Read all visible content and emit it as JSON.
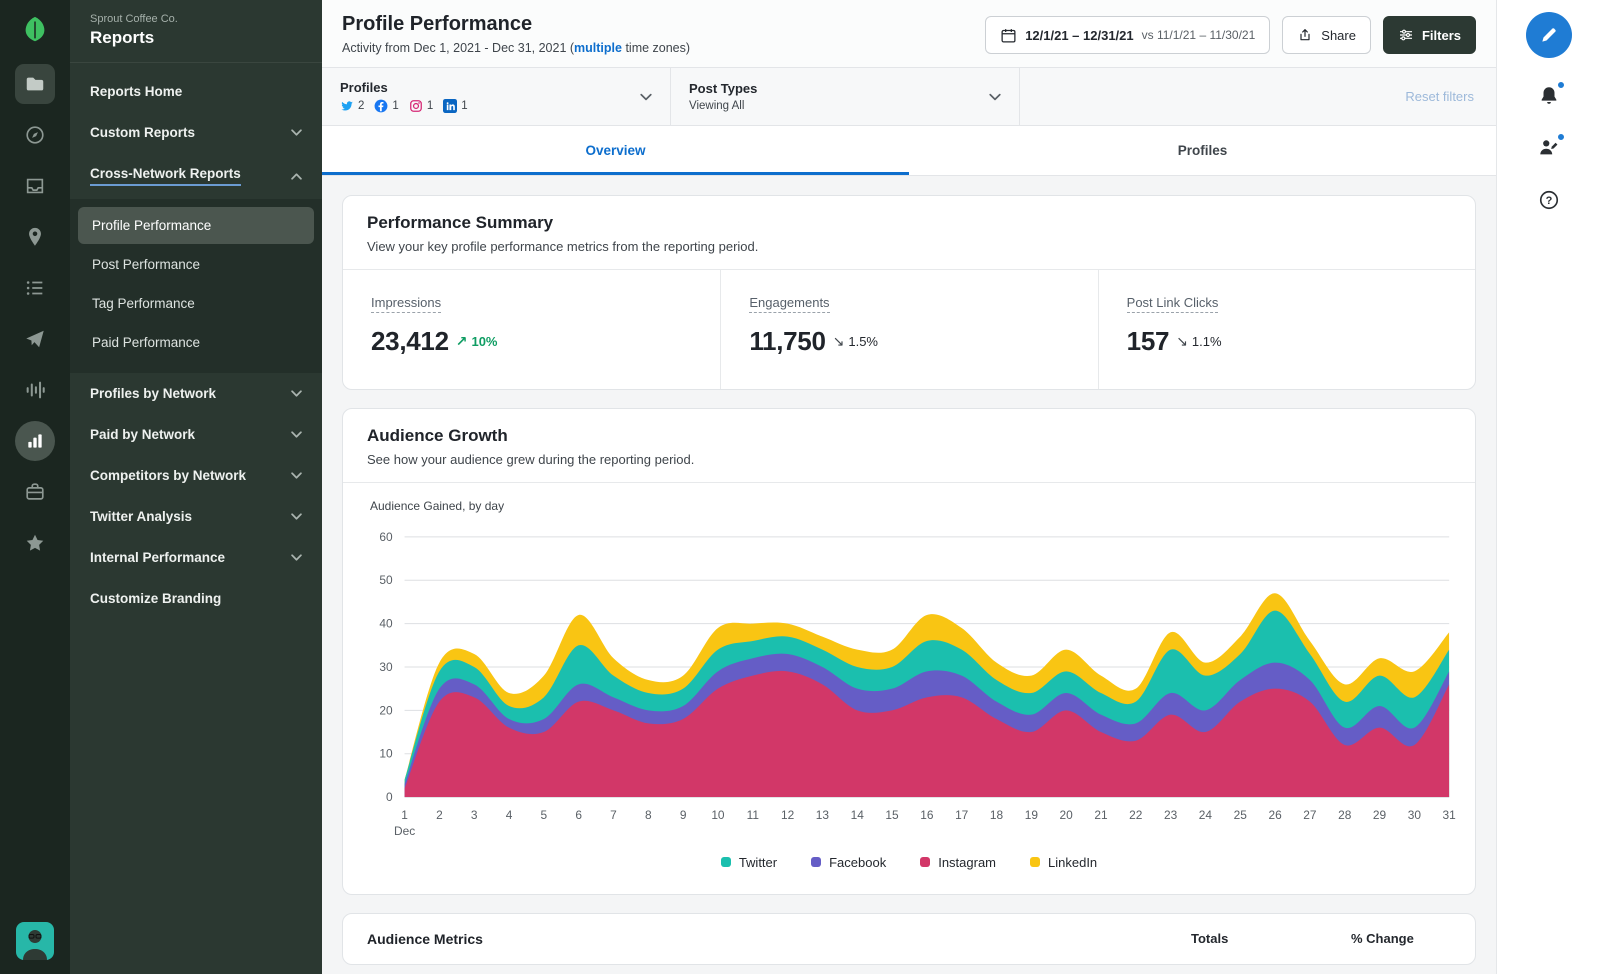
{
  "brand": {
    "company": "Sprout Coffee Co.",
    "section": "Reports"
  },
  "sidebar": {
    "items": [
      {
        "label": "Reports Home"
      },
      {
        "label": "Custom Reports",
        "chevron": "down"
      },
      {
        "label": "Cross-Network Reports",
        "chevron": "up",
        "active": true
      }
    ],
    "sub_items": [
      {
        "label": "Profile Performance",
        "selected": true
      },
      {
        "label": "Post Performance"
      },
      {
        "label": "Tag Performance"
      },
      {
        "label": "Paid Performance"
      }
    ],
    "items_lower": [
      {
        "label": "Profiles by Network",
        "chevron": "down"
      },
      {
        "label": "Paid by Network",
        "chevron": "down"
      },
      {
        "label": "Competitors by Network",
        "chevron": "down"
      },
      {
        "label": "Twitter Analysis",
        "chevron": "down"
      },
      {
        "label": "Internal Performance",
        "chevron": "down"
      },
      {
        "label": "Customize Branding"
      }
    ]
  },
  "header": {
    "title": "Profile Performance",
    "subtitle_prefix": "Activity from Dec 1, 2021 - Dec 31, 2021 (",
    "subtitle_link": "multiple",
    "subtitle_suffix": " time zones)",
    "date_range": "12/1/21 – 12/31/21",
    "date_compare": "vs 11/1/21 – 11/30/21",
    "share_label": "Share",
    "filters_label": "Filters"
  },
  "filter_bar": {
    "profiles_label": "Profiles",
    "profiles_counts": [
      {
        "network": "twitter",
        "count": "2"
      },
      {
        "network": "facebook",
        "count": "1"
      },
      {
        "network": "instagram",
        "count": "1"
      },
      {
        "network": "linkedin",
        "count": "1"
      }
    ],
    "post_types_label": "Post Types",
    "post_types_value": "Viewing All",
    "reset_label": "Reset filters"
  },
  "tabs": [
    {
      "label": "Overview",
      "active": true
    },
    {
      "label": "Profiles",
      "active": false
    }
  ],
  "performance_summary": {
    "title": "Performance Summary",
    "description": "View your key profile performance metrics from the reporting period.",
    "metrics": [
      {
        "label": "Impressions",
        "value": "23,412",
        "arrow": "↗",
        "change": "10%",
        "direction": "up"
      },
      {
        "label": "Engagements",
        "value": "11,750",
        "arrow": "↘",
        "change": "1.5%",
        "direction": "down"
      },
      {
        "label": "Post Link Clicks",
        "value": "157",
        "arrow": "↘",
        "change": "1.1%",
        "direction": "down"
      }
    ]
  },
  "audience_growth": {
    "title": "Audience Growth",
    "description": "See how your audience grew during the reporting period.",
    "chart_label": "Audience Gained, by day"
  },
  "audience_metrics": {
    "title": "Audience Metrics",
    "col_totals": "Totals",
    "col_change": "% Change"
  },
  "colors": {
    "accent_blue": "#0d6ecd",
    "positive_green": "#0f9d63",
    "twitter_brand": "#1da1f2",
    "facebook_brand": "#1877f2",
    "instagram_brand": "#d62976",
    "linkedin_brand": "#0a66c2"
  },
  "chart_data": {
    "type": "area",
    "stacked": true,
    "title": "Audience Gained, by day",
    "x_label_month": "Dec",
    "x": [
      1,
      2,
      3,
      4,
      5,
      6,
      7,
      8,
      9,
      10,
      11,
      12,
      13,
      14,
      15,
      16,
      17,
      18,
      19,
      20,
      21,
      22,
      23,
      24,
      25,
      26,
      27,
      28,
      29,
      30,
      31
    ],
    "ylim": [
      0,
      60
    ],
    "yticks": [
      0,
      10,
      20,
      30,
      40,
      50,
      60
    ],
    "grid": true,
    "legend_position": "bottom",
    "stack_order": [
      "Instagram",
      "Facebook",
      "Twitter",
      "LinkedIn"
    ],
    "series": [
      {
        "name": "Twitter",
        "color": "#1bbfae",
        "values": [
          1,
          4,
          4,
          3,
          5,
          9,
          5,
          4,
          4,
          5,
          4,
          4,
          4,
          5,
          5,
          7,
          6,
          5,
          5,
          5,
          5,
          5,
          10,
          8,
          6,
          12,
          6,
          6,
          7,
          7,
          5
        ]
      },
      {
        "name": "Facebook",
        "color": "#655dc6",
        "values": [
          1,
          3,
          3,
          2,
          3,
          4,
          3,
          3,
          3,
          4,
          4,
          4,
          4,
          5,
          5,
          6,
          5,
          4,
          4,
          4,
          4,
          4,
          5,
          5,
          5,
          6,
          5,
          4,
          5,
          4,
          3
        ]
      },
      {
        "name": "Instagram",
        "color": "#d23768",
        "values": [
          2,
          22,
          23,
          16,
          15,
          22,
          20,
          17,
          18,
          25,
          28,
          29,
          26,
          20,
          20,
          23,
          23,
          18,
          15,
          20,
          15,
          13,
          19,
          15,
          22,
          25,
          22,
          12,
          16,
          12,
          26
        ]
      },
      {
        "name": "LinkedIn",
        "color": "#f9c513",
        "values": [
          0,
          2,
          3,
          3,
          5,
          7,
          4,
          3,
          3,
          5,
          4,
          3,
          3,
          4,
          4,
          6,
          5,
          4,
          4,
          5,
          4,
          3,
          4,
          3,
          4,
          4,
          3,
          4,
          4,
          6,
          4
        ]
      }
    ]
  }
}
